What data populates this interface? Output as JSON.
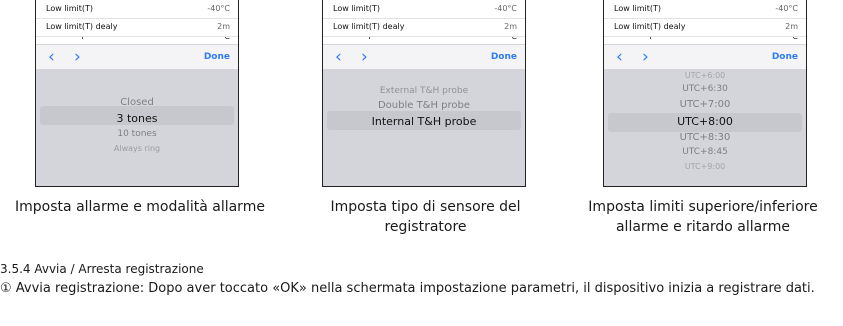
{
  "screens": [
    {
      "rows": [
        {
          "label": "Low limit(T)",
          "value": "-40°C"
        },
        {
          "label": "Low limit(T) dealy",
          "value": "2m"
        }
      ],
      "cut_row": {
        "label": "T",
        "value": "°C"
      },
      "toolbar": {
        "prev": "‹",
        "next": "›",
        "done": "Done"
      },
      "options": [
        "Closed",
        "3 tones",
        "10 tones",
        "Always ring"
      ],
      "selected_index": 1
    },
    {
      "rows": [
        {
          "label": "Low limit(T)",
          "value": "-40°C"
        },
        {
          "label": "Low limit(T) dealy",
          "value": "2m"
        }
      ],
      "cut_row": {
        "label": "T",
        "value": "°C"
      },
      "toolbar": {
        "prev": "‹",
        "next": "›",
        "done": "Done"
      },
      "options": [
        "External T&H probe",
        "Double T&H probe",
        "Internal T&H probe"
      ],
      "selected_index": 2
    },
    {
      "rows": [
        {
          "label": "Low limit(T)",
          "value": "-40°C"
        },
        {
          "label": "Low limit(T) dealy",
          "value": "2m"
        }
      ],
      "cut_row": {
        "label": "T",
        "value": "°C"
      },
      "toolbar": {
        "prev": "‹",
        "next": "›",
        "done": "Done"
      },
      "options": [
        "UTC+6:00",
        "UTC+6:30",
        "UTC+7:00",
        "UTC+8:00",
        "UTC+8:30",
        "UTC+8:45",
        "UTC+9:00"
      ],
      "selected_index": 3
    }
  ],
  "captions": [
    "Imposta allarme e modalità allarme",
    "Imposta tipo di sensore del registratore",
    "Imposta limiti superiore/inferiore allarme e ritardo allarme"
  ],
  "section_heading": "3.5.4 Avvia / Arresta registrazione",
  "paragraph": "① Avvia registrazione: Dopo aver toccato «OK» nella schermata impostazione parametri, il dispositivo inizia a registrare dati.",
  "colors": {
    "accent": "#2f7cf6",
    "picker_bg": "#d3d5da",
    "selected_text": "#111111",
    "unselected_text": "#7d7f84"
  }
}
